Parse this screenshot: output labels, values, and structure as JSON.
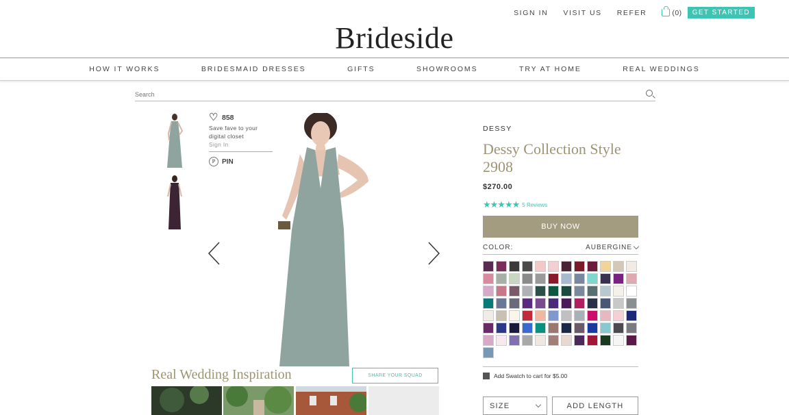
{
  "topbar": {
    "sign_in": "SIGN IN",
    "visit_us": "VISIT US",
    "refer": "REFER",
    "cart_count": "(0)",
    "get_started": "GET STARTED"
  },
  "logo": "Brideside",
  "nav": [
    "HOW IT WORKS",
    "BRIDESMAID DRESSES",
    "GIFTS",
    "SHOWROOMS",
    "TRY AT HOME",
    "REAL WEDDINGS"
  ],
  "search": {
    "placeholder": "Search"
  },
  "fave": {
    "count": "858",
    "text": "Save fave to your digital closet",
    "sign_in": "Sign In",
    "pin": "PIN"
  },
  "gallery": {
    "main_color": "#8fa49f",
    "alt_color": "#3b2535"
  },
  "inspiration": {
    "title": "Real Wedding Inspiration",
    "share": "SHARE YOUR SQUAD"
  },
  "product": {
    "brand": "DESSY",
    "title": "Dessy Collection Style 2908",
    "price": "$270.00",
    "rating": 5,
    "reviews": "5 Reviews",
    "buy": "BUY NOW",
    "color_label": "COLOR:",
    "color_selected": "AUBERGINE",
    "add_swatch": "Add Swatch to cart for $5.00",
    "size": "SIZE",
    "add_length": "ADD LENGTH"
  },
  "swatch_colors": [
    "#5b2a52",
    "#7a2d5a",
    "#3a3a3a",
    "#4a4a4a",
    "#f4c8c8",
    "#f1cfd2",
    "#4a2236",
    "#7a1a2a",
    "#6c1d3a",
    "#f0d49a",
    "#d6c8b8",
    "#f2ebe4",
    "#d98aa0",
    "#a6b0a6",
    "#c8d8c0",
    "#8a8a8a",
    "#9a9a9a",
    "#8a1a2a",
    "#a8b8d0",
    "#7888a0",
    "#7fd8d0",
    "#3a3050",
    "#7a2280",
    "#e0a8b0",
    "#d8a8c8",
    "#c87888",
    "#7a5a6a",
    "#b0b0b8",
    "#2a5048",
    "#0a5840",
    "#1a4a40",
    "#7a8a9a",
    "#5a7070",
    "#b8c8d0",
    "#f4f0ea",
    "#ffffff",
    "#0a7a78",
    "#6a7898",
    "#6a6a78",
    "#5a2a80",
    "#7a4a90",
    "#4a2a7a",
    "#4a1a5a",
    "#b02060",
    "#2a3048",
    "#4a5878",
    "#c8c8c8",
    "#8a9090",
    "#f0ece6",
    "#c8c0b0",
    "#fbf6ec",
    "#c02a3a",
    "#f0b8a0",
    "#8098d0",
    "#c0c0c0",
    "#a8b0b8",
    "#c8106a",
    "#e8b8c0",
    "#f4d0d4",
    "#1a2878",
    "#6a2a6a",
    "#2a3a88",
    "#1a1a3a",
    "#3a6ad0",
    "#0a9080",
    "#9a7870",
    "#1a2848",
    "#6a5a6a",
    "#1a3aa0",
    "#88c8d0",
    "#4a4a50",
    "#7a7a80",
    "#d8a8c8",
    "#f8e8f0",
    "#8070b0",
    "#a8a8a8",
    "#f0e8e0",
    "#a08078",
    "#e8d8d0",
    "#4a2a5a",
    "#a01838",
    "#1a3a20",
    "#f6f6f4",
    "#5a1a48",
    "#7898b8"
  ]
}
